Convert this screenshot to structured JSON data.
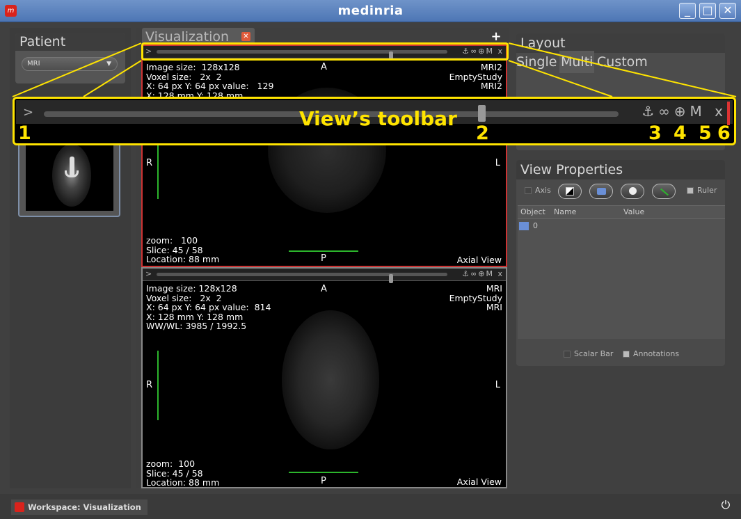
{
  "window": {
    "title": "medinria"
  },
  "patient": {
    "header": "Patient",
    "selected": "MRI"
  },
  "visualization_tab": {
    "label": "Visualization"
  },
  "view_top": {
    "left_overlay": "Image size:  128x128\nVoxel size:   2x  2\nX: 64 px Y: 64 px value:   129\nX: 128 mm Y: 128 mm",
    "right_overlay": "MRI2\nEmptyStudy\nMRI2",
    "dir_top": "A",
    "dir_left": "R",
    "dir_right": "L",
    "dir_bottom": "P",
    "bottom_left": "zoom:   100\nSlice: 45 / 58\nLocation: 88 mm",
    "bottom_right": "Axial View",
    "toolbar_expand": ">",
    "toolbar_icons": "⚓∞⊕M x"
  },
  "view_bottom": {
    "left_overlay": "Image size: 128x128\nVoxel size:   2x  2\nX: 64 px Y: 64 px value:  814\nX: 128 mm Y: 128 mm\nWW/WL: 3985 / 1992.5",
    "right_overlay": "MRI\nEmptyStudy\nMRI",
    "dir_top": "A",
    "dir_left": "R",
    "dir_right": "L",
    "dir_bottom": "P",
    "bottom_left": "zoom:  100\nSlice: 45 / 58\nLocation: 88 mm",
    "bottom_right": "Axial View",
    "toolbar_expand": ">",
    "toolbar_icons": "⚓∞⊕M x"
  },
  "callout": {
    "label": "View’s toolbar",
    "expand": ">",
    "icons": "⚓∞⊕M x",
    "numbers": [
      "1",
      "2",
      "3",
      "4",
      "5",
      "6"
    ]
  },
  "layout": {
    "header": "Layout",
    "tabs": [
      "Single",
      "Multi",
      "Custom"
    ]
  },
  "view_properties": {
    "header": "View Properties",
    "axis_label": "Axis",
    "ruler_label": "Ruler",
    "columns": [
      "Object",
      "Name",
      "Value"
    ],
    "rows": [
      {
        "object": "0"
      }
    ],
    "scalar_bar_label": "Scalar Bar",
    "annotations_label": "Annotations"
  },
  "statusbar": {
    "workspace": "Workspace: Visualization"
  },
  "icons": {
    "app": "app-logo-icon",
    "power": "power-icon",
    "minimize": "minimize-icon",
    "maximize": "maximize-icon",
    "close": "close-icon"
  },
  "colors": {
    "titlebar": "#5a80bf",
    "accent_annotation": "#ffe400",
    "active_view_border": "#cc3333",
    "ruler": "#2cb52c"
  }
}
